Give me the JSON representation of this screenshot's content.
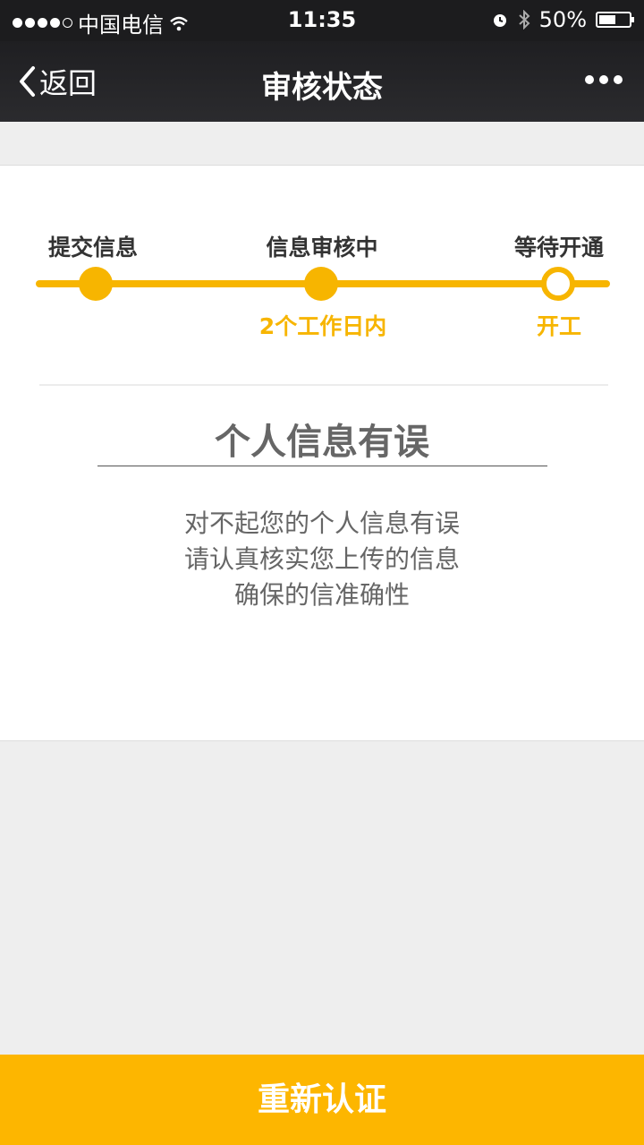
{
  "status_bar": {
    "carrier": "中国电信",
    "time": "11:35",
    "battery": "50%"
  },
  "nav": {
    "back_label": "返回",
    "title": "审核状态"
  },
  "progress": {
    "steps": [
      {
        "label": "提交信息",
        "sub": "",
        "state": "done"
      },
      {
        "label": "信息审核中",
        "sub": "2个工作日内",
        "state": "done"
      },
      {
        "label": "等待开通",
        "sub": "开工",
        "state": "pending"
      }
    ],
    "accent_color": "#f7b500"
  },
  "result": {
    "title": "个人信息有误",
    "lines": [
      "对不起您的个人信息有误",
      "请认真核实您上传的信息",
      "确保的信准确性"
    ]
  },
  "footer": {
    "button_label": "重新认证"
  }
}
